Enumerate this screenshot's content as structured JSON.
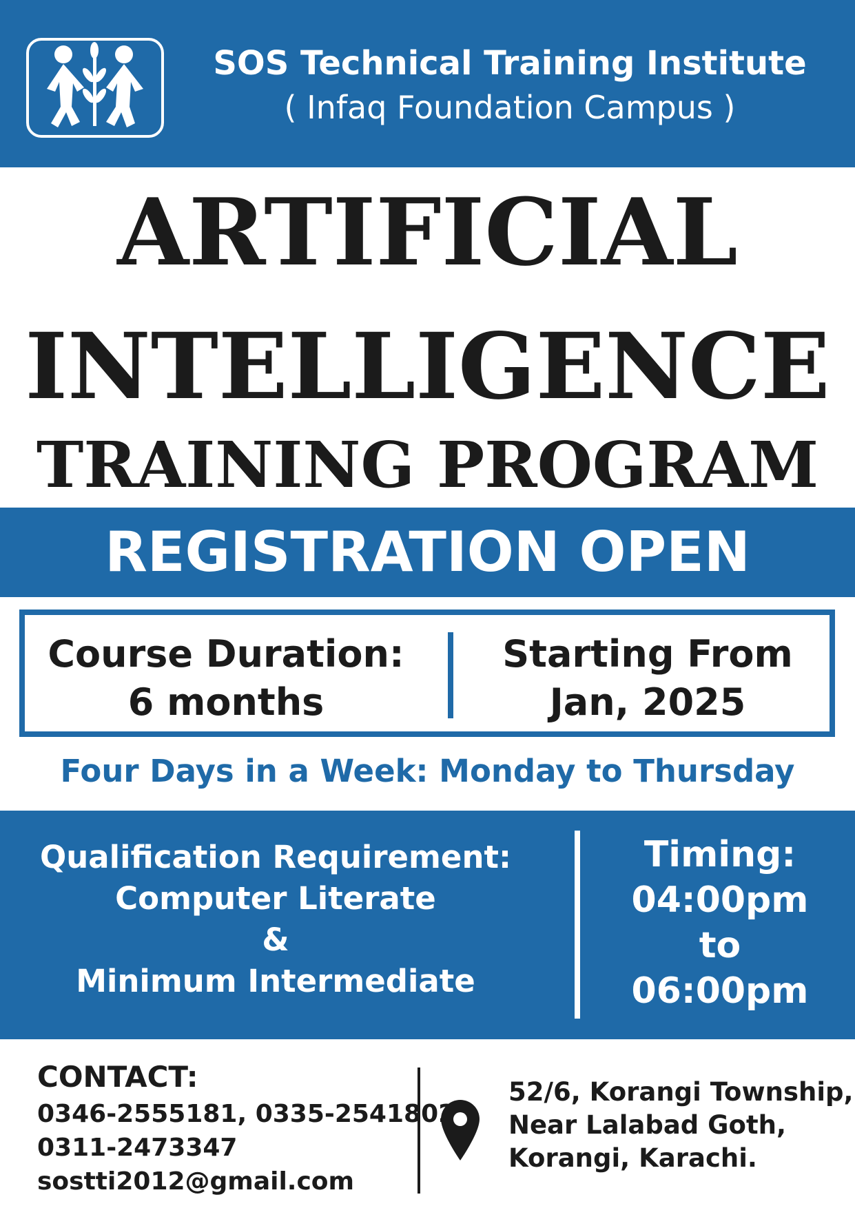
{
  "colors": {
    "brand_blue": "#1f6aa8",
    "text_dark": "#1b1b1b",
    "white": "#ffffff"
  },
  "header": {
    "logo_icon": "sos-children-logo",
    "institute": "SOS Technical Training Institute",
    "campus": "( Infaq Foundation Campus )"
  },
  "title": {
    "line1": "ARTIFICIAL",
    "line2": "INTELLIGENCE",
    "line3": "TRAINING PROGRAM"
  },
  "registration": "REGISTRATION OPEN",
  "course": {
    "duration_label": "Course Duration:",
    "duration_value": "6 months",
    "start_label": "Starting From",
    "start_value": "Jan, 2025"
  },
  "schedule": "Four Days in a Week: Monday to Thursday",
  "qualification": {
    "label": "Qualification Requirement:",
    "line1": "Computer Literate",
    "amp": "&",
    "line2": "Minimum Intermediate"
  },
  "timing": {
    "label": "Timing:",
    "start": "04:00pm",
    "to": "to",
    "end": "06:00pm"
  },
  "contact": {
    "label": "CONTACT:",
    "phones1": "0346-2555181, 0335-2541802",
    "phones2": "0311-2473347",
    "email": "sostti2012@gmail.com"
  },
  "address": {
    "icon": "location-pin-icon",
    "line1": "52/6, Korangi Township,",
    "line2": "Near Lalabad Goth,",
    "line3": "Korangi, Karachi."
  }
}
